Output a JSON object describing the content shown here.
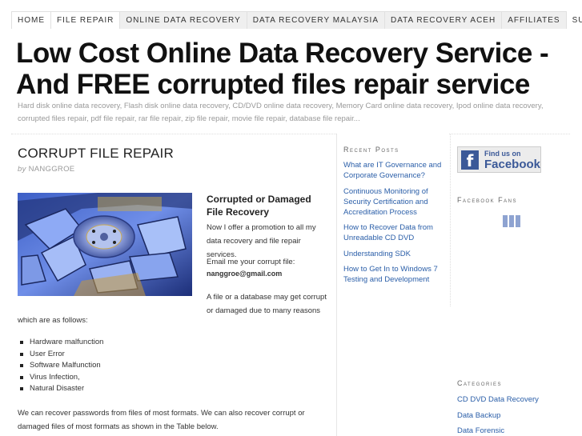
{
  "nav": {
    "items": [
      {
        "label": "HOME"
      },
      {
        "label": "FILE REPAIR"
      },
      {
        "label": "ONLINE DATA RECOVERY"
      },
      {
        "label": "DATA RECOVERY MALAYSIA"
      },
      {
        "label": "DATA RECOVERY ACEH"
      },
      {
        "label": "AFFILIATES"
      }
    ],
    "subscribe_label": "SUBSCRIBE",
    "subscribe_icon": "rss-feed-icon",
    "active": "FILE REPAIR"
  },
  "header": {
    "title": "Low Cost Online Data Recovery Service - And FREE corrupted files repair service",
    "tagline": "Hard disk online data recovery, Flash disk online data recovery, CD/DVD online data recovery, Memory Card online data recovery, Ipod online data recovery, corrupted files repair, pdf file repair, rar file repair, zip file repair, movie file repair, database file repair..."
  },
  "post": {
    "title": "CORRUPT FILE REPAIR",
    "by": "by",
    "author": "NANGGROE",
    "image_alt": "broken-hard-disk-platter-image",
    "aside_heading": "Corrupted or Damaged File Recovery",
    "promo": "Now I offer a promotion to all my data recovery and file repair services.",
    "email_label": "Email me your corrupt file:",
    "email": "nanggroe@gmail.com",
    "reasons_intro_1": "A file or a database may get corrupt or damaged due to many reasons",
    "reasons_intro_2": "which are as follows:",
    "reasons": [
      "Hardware malfunction",
      "User Error",
      "Software Malfunction",
      "Virus Infection,",
      "Natural Disaster"
    ],
    "closing": "We can recover passwords from files of most formats. We can also recover corrupt or damaged files of most formats as shown in the Table below."
  },
  "sidebar": {
    "recent_posts": {
      "title": "Recent Posts",
      "items": [
        "What are IT Governance and Corporate Governance?",
        "Continuous Monitoring of Security Certification and Accreditation Process",
        "How to Recover Data from Unreadable CD DVD",
        "Understanding SDK",
        "How to Get In to Windows 7 Testing and Development"
      ]
    },
    "facebook_badge": {
      "small": "Find us on",
      "big": "Facebook",
      "icon": "facebook-f-icon",
      "color": "#3b5998"
    },
    "facebook_fans": {
      "title": "Facebook Fans"
    },
    "categories": {
      "title": "Categories",
      "items": [
        "CD DVD Data Recovery",
        "Data Backup",
        "Data Forensic"
      ]
    }
  },
  "colors": {
    "link": "#2a5ea8",
    "facebook": "#3b5998",
    "rss": "#e8a020"
  }
}
